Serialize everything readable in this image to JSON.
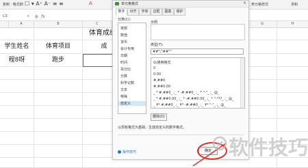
{
  "ribbon": {
    "paste_label": "复制 · 格式刷",
    "right_items": [
      "表元格样式",
      "求和"
    ]
  },
  "formula_bar": {
    "name_box": "C3",
    "fx_label": "fx"
  },
  "columns": [
    "A",
    "B",
    "C",
    "D",
    "E",
    "F",
    "G",
    "H"
  ],
  "sheet": {
    "title": "体育成绩统计表",
    "header_row": [
      "学生姓名",
      "体育项目",
      "成"
    ],
    "data_row": [
      "程8呀",
      "跑步",
      ""
    ]
  },
  "dialog": {
    "title": "单元格格式",
    "close": "×",
    "tabs": [
      "数字",
      "对齐",
      "字体",
      "边框",
      "图案",
      "保护"
    ],
    "category_label": "分类(C):",
    "categories": [
      "常规",
      "数值",
      "货币",
      "会计专用",
      "日期",
      "时间",
      "百分比",
      "分数",
      "科学记数",
      "文本",
      "特殊",
      "自定义"
    ],
    "selected_category": "自定义",
    "sample_label": "示例",
    "type_label": "类型(T):",
    "type_value": "##\";\"##\"\"",
    "formats": [
      "G/通用格式",
      "0",
      "0.00",
      "#,##0",
      "#,##0.00",
      "_ * #,##0_ ;_ * -#,##0_ ;_ * \"-\"_ ;_ @_",
      "_ * #,##0.00_ ;_ * -#,##0.00_ ;_ * \"-\"??_ ;_ @_",
      "_ ¥* #,##0_ ;_ ¥* -#,##0_ ;_ ¥* \"-\"_ ;_ @_"
    ],
    "delete_label": "删除(D)",
    "description": "以现有格式为基础，生成自定义的数字格式。",
    "tips_label": "操作技巧",
    "ok_label": "确定"
  },
  "watermark": "软件技巧",
  "colors": {
    "accent_red": "#d8322b",
    "tab_selected": "#d6e6f7"
  }
}
